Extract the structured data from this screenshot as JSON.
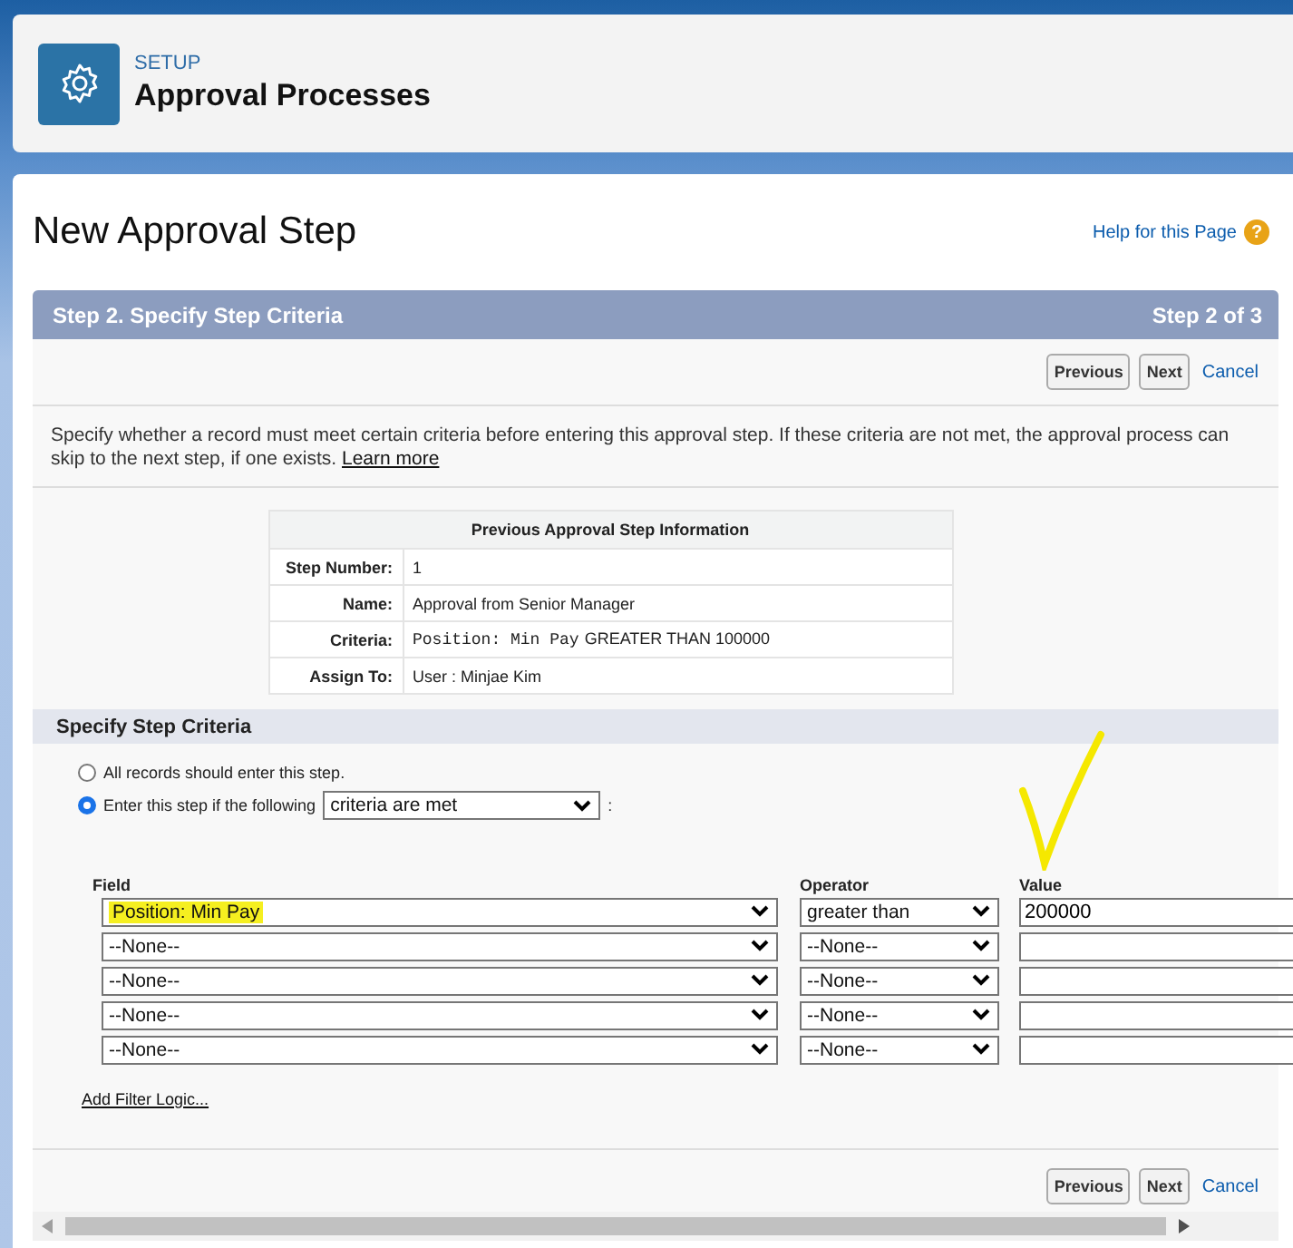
{
  "header": {
    "eyebrow": "SETUP",
    "title": "Approval Processes"
  },
  "page": {
    "title": "New Approval Step",
    "help_link": "Help for this Page",
    "help_icon": "?"
  },
  "section": {
    "title": "Step 2. Specify Step Criteria",
    "step": "Step 2 of 3"
  },
  "top_buttons": {
    "buttons": [
      "Previous",
      "Next"
    ],
    "cancel": "Cancel"
  },
  "bottom_buttons": {
    "buttons": [
      "Previous",
      "Next"
    ],
    "cancel": "Cancel"
  },
  "description": "Specify whether a record must meet certain criteria before entering this approval step. If these criteria are not met, the approval process can skip to the next step, if one exists.",
  "learn_more": "Learn more",
  "previous_step": {
    "title": "Previous Approval Step Information",
    "rows": [
      {
        "label": "Step Number:",
        "value": "1",
        "code": ""
      },
      {
        "label": "Name:",
        "value": "Approval from Senior Manager",
        "code": ""
      },
      {
        "label": "Criteria:",
        "value": "GREATER THAN 100000",
        "code": "Position: Min Pay"
      },
      {
        "label": "Assign To:",
        "value": "User : Minjae Kim",
        "code": ""
      }
    ]
  },
  "criteria": {
    "title": "Specify Step Criteria",
    "options": [
      {
        "label": "All records should enter this step.",
        "selected": false
      },
      {
        "label": "Enter this step if the following",
        "selected": true,
        "dropdown": "criteria are met",
        "suffix": ":"
      }
    ],
    "columns": [
      "Field",
      "Operator",
      "Value"
    ],
    "rows": [
      {
        "field": "Position: Min Pay",
        "operator": "greater than",
        "value": "200000",
        "highlighted": true
      },
      {
        "field": "--None--",
        "operator": "--None--",
        "value": "",
        "highlighted": false
      },
      {
        "field": "--None--",
        "operator": "--None--",
        "value": "",
        "highlighted": false
      },
      {
        "field": "--None--",
        "operator": "--None--",
        "value": "",
        "highlighted": false
      },
      {
        "field": "--None--",
        "operator": "--None--",
        "value": "",
        "highlighted": false
      }
    ],
    "filter_logic": "Add Filter Logic..."
  }
}
